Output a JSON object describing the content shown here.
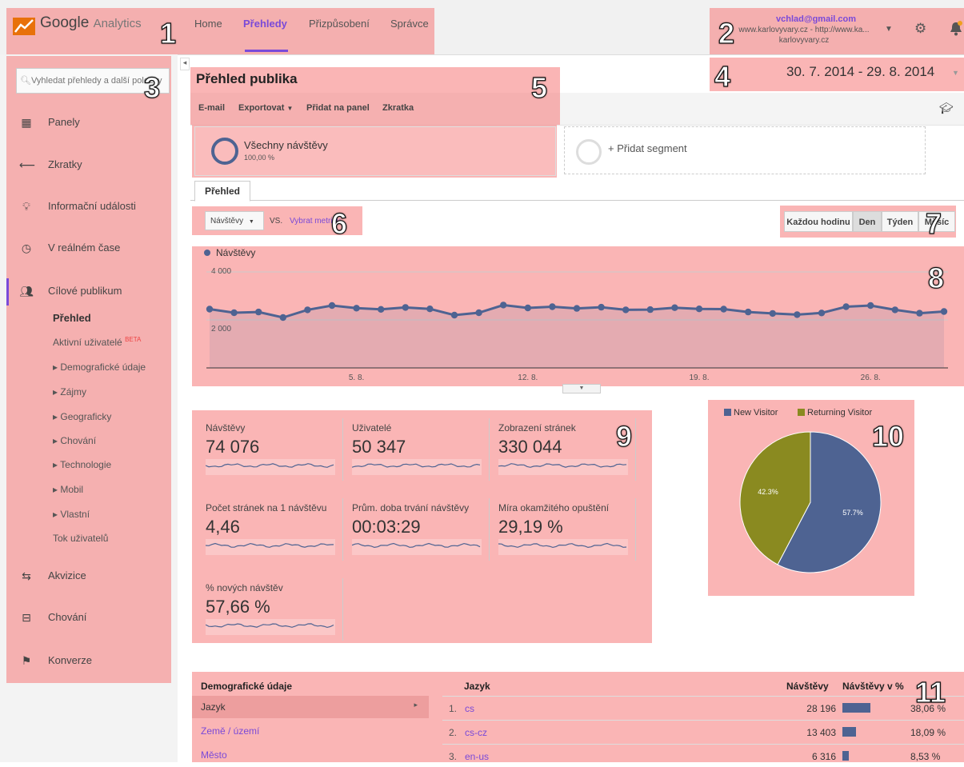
{
  "topbar": {
    "logo_google": "Google",
    "logo_analytics": "Analytics",
    "nav": [
      "Home",
      "Přehledy",
      "Přizpůsobení",
      "Správce"
    ],
    "active_nav": "Přehledy",
    "account_email": "vchlad@gmail.com",
    "account_property_line1": "www.karlovyvary.cz - http://www.ka...",
    "account_property_line2": "karlovyvary.cz"
  },
  "sidebar": {
    "search_placeholder": "Vyhledat přehledy a další položky",
    "items": [
      {
        "label": "Panely",
        "icon": "grid-icon"
      },
      {
        "label": "Zkratky",
        "icon": "shortcut-arrow-icon"
      },
      {
        "label": "Informační události",
        "icon": "lightbulb-icon"
      },
      {
        "label": "V reálném čase",
        "icon": "clock-icon"
      },
      {
        "label": "Cílové publikum",
        "icon": "audience-icon"
      }
    ],
    "audience_sub": {
      "overview": "Přehled",
      "active_users": "Aktivní uživatelé",
      "beta": "BETA",
      "demographics": "Demografické údaje",
      "interests": "Zájmy",
      "geo": "Geograficky",
      "behavior": "Chování",
      "technology": "Technologie",
      "mobile": "Mobil",
      "custom": "Vlastní",
      "user_flow": "Tok uživatelů"
    },
    "bottom_items": [
      {
        "label": "Akvizice",
        "icon": "acquisition-icon"
      },
      {
        "label": "Chování",
        "icon": "behavior-icon"
      },
      {
        "label": "Konverze",
        "icon": "flag-icon"
      }
    ]
  },
  "report": {
    "title": "Přehled publika",
    "toolbar": [
      "E-mail",
      "Exportovat",
      "Přidat na panel",
      "Zkratka"
    ],
    "date_range": "30. 7. 2014 - 29. 8. 2014",
    "segment_name": "Všechny návštěvy",
    "segment_pct": "100,00 %",
    "add_segment": "+ Přidat segment",
    "tab": "Přehled",
    "metric_select": "Návštěvy",
    "vs": "VS.",
    "select_metric": "Vybrat metriku",
    "granularity": [
      "Každou hodinu",
      "Den",
      "Týden",
      "Měsíc"
    ],
    "active_granularity": "Den"
  },
  "chart_data": [
    {
      "type": "line",
      "series": [
        {
          "name": "Návštěvy",
          "values": [
            2450,
            2300,
            2330,
            2100,
            2420,
            2600,
            2490,
            2440,
            2520,
            2460,
            2200,
            2300,
            2620,
            2500,
            2550,
            2480,
            2530,
            2420,
            2430,
            2510,
            2460,
            2450,
            2330,
            2270,
            2220,
            2290,
            2550,
            2600,
            2420,
            2280,
            2350
          ]
        }
      ],
      "xtick_labels": [
        "5. 8.",
        "12. 8.",
        "19. 8.",
        "26. 8."
      ],
      "xtick_indices": [
        6,
        13,
        20,
        27
      ],
      "yticks": [
        "4 000",
        "2 000"
      ],
      "ylim": [
        0,
        4000
      ],
      "color": "#4e6392"
    },
    {
      "type": "pie",
      "categories": [
        "New Visitor",
        "Returning Visitor"
      ],
      "values": [
        57.7,
        42.3
      ],
      "labels": [
        "57.7%",
        "42.3%"
      ],
      "colors": [
        "#4e6392",
        "#8a8a20"
      ],
      "legend": "top"
    }
  ],
  "stats": [
    {
      "label": "Návštěvy",
      "value": "74 076"
    },
    {
      "label": "Uživatelé",
      "value": "50 347"
    },
    {
      "label": "Zobrazení stránek",
      "value": "330 044"
    },
    {
      "label": "Počet stránek na 1 návštěvu",
      "value": "4,46"
    },
    {
      "label": "Prům. doba trvání návštěvy",
      "value": "00:03:29"
    },
    {
      "label": "Míra okamžitého opuštění",
      "value": "29,19 %"
    },
    {
      "label": "% nových návštěv",
      "value": "57,66 %"
    }
  ],
  "table": {
    "left_header": "Demografické údaje",
    "left_rows": [
      "Jazyk",
      "Země / území",
      "Město"
    ],
    "headers": [
      "Jazyk",
      "Návštěvy",
      "Návštěvy v %"
    ],
    "rows": [
      {
        "rank": "1.",
        "lang": "cs",
        "visits": "28 196",
        "pct": "38,06 %",
        "frac": 0.3806
      },
      {
        "rank": "2.",
        "lang": "cs-cz",
        "visits": "13 403",
        "pct": "18,09 %",
        "frac": 0.1809
      },
      {
        "rank": "3.",
        "lang": "en-us",
        "visits": "6 316",
        "pct": "8,53 %",
        "frac": 0.0853
      }
    ]
  },
  "annotations": [
    "1",
    "2",
    "3",
    "4",
    "5",
    "6",
    "7",
    "8",
    "9",
    "10",
    "11"
  ],
  "colors": {
    "highlight": "#f57878",
    "accent": "#7a4ad8",
    "series": "#4e6392"
  }
}
